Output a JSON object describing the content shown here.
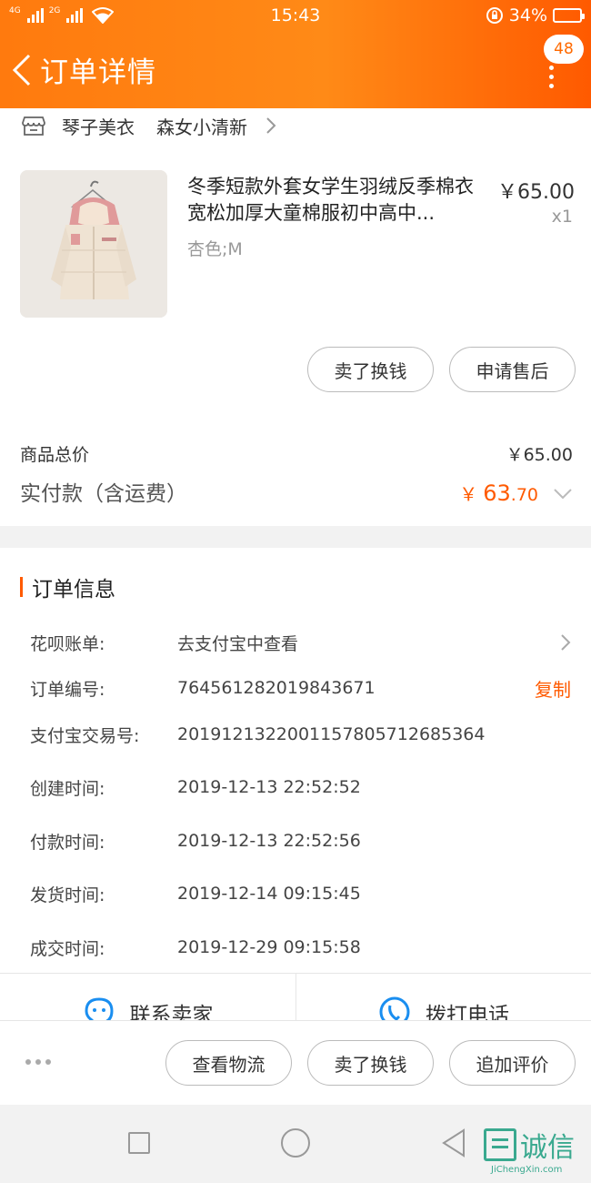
{
  "status_bar": {
    "network_left": "4G",
    "network_right": "2G",
    "time": "15:43",
    "battery": "34%",
    "battery_level": 0.34
  },
  "header": {
    "title": "订单详情",
    "badge": "48"
  },
  "shop": {
    "name": "琴子美衣",
    "subname": "森女小清新"
  },
  "product": {
    "name": "冬季短款外套女学生羽绒反季棉衣宽松加厚大童棉服初中高中...",
    "price": "￥65.00",
    "quantity": "x1",
    "spec": "杏色;M"
  },
  "product_actions": {
    "sell_label": "卖了换钱",
    "after_sale_label": "申请售后"
  },
  "totals": {
    "goods_label": "商品总价",
    "goods_value": "￥65.00",
    "paid_label": "实付款（含运费）",
    "paid_currency": "￥",
    "paid_main": "63",
    "paid_decimal": ".70"
  },
  "order_info": {
    "title": "订单信息",
    "huabei_label": "花呗账单:",
    "huabei_value": "去支付宝中查看",
    "order_no_label": "订单编号:",
    "order_no_value": "764561282019843671",
    "copy_label": "复制",
    "alipay_label": "支付宝交易号:",
    "alipay_value": "2019121322001157805712685364",
    "created_label": "创建时间:",
    "created_value": "2019-12-13 22:52:52",
    "paid_label": "付款时间:",
    "paid_value": "2019-12-13 22:52:56",
    "shipped_label": "发货时间:",
    "shipped_value": "2019-12-14 09:15:45",
    "done_label": "成交时间:",
    "done_value": "2019-12-29 09:15:58"
  },
  "contact": {
    "seller_label": "联系卖家",
    "call_label": "拨打电话"
  },
  "bottom_actions": {
    "logistics_label": "查看物流",
    "sell_label": "卖了换钱",
    "review_label": "追加评价"
  },
  "watermark": {
    "logo_text": "诚信",
    "url": "JiChengXin.com"
  }
}
